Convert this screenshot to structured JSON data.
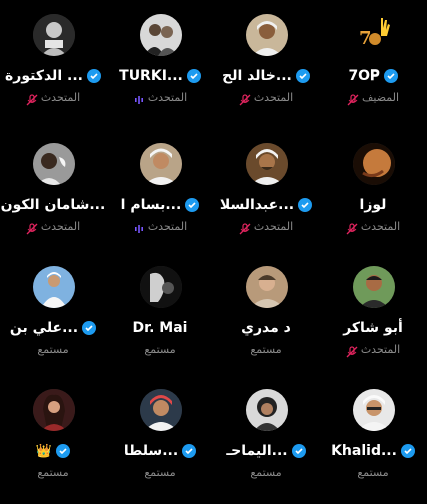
{
  "colors": {
    "background": "#000000",
    "verified": "#1d9bf0",
    "muted_mic": "#e0245e",
    "speaking": "#7856ff",
    "role_text": "#8b8b8b"
  },
  "participants": [
    {
      "name": "7O𝐏",
      "role": "المضيف",
      "verified": true,
      "mic": "muted",
      "avatar": "hand-logo"
    },
    {
      "name": "خالد الح...",
      "role": "المتحدث",
      "verified": true,
      "mic": "muted",
      "avatar": "photo"
    },
    {
      "name": "TURKI...",
      "role": "المتحدث",
      "verified": true,
      "mic": "speaking",
      "avatar": "photo"
    },
    {
      "name": "الدكتورة ...",
      "role": "المتحدث",
      "verified": true,
      "mic": "muted",
      "avatar": "photo"
    },
    {
      "name": "لوزا",
      "role": "المتحدث",
      "verified": false,
      "mic": "muted",
      "avatar": "photo"
    },
    {
      "name": "عبدالسلا...",
      "role": "المتحدث",
      "verified": true,
      "mic": "muted",
      "avatar": "photo"
    },
    {
      "name": "بسام ا...",
      "role": "المتحدث",
      "verified": true,
      "mic": "speaking",
      "avatar": "photo"
    },
    {
      "name": "شامان الكون...",
      "role": "المتحدث",
      "verified": false,
      "mic": "muted",
      "avatar": "photo"
    },
    {
      "name": "أبو شاكر",
      "role": "المتحدث",
      "verified": false,
      "mic": "muted",
      "avatar": "photo"
    },
    {
      "name": "د مدري",
      "role": "مستمع",
      "verified": false,
      "mic": "none",
      "avatar": "photo"
    },
    {
      "name": "Dr. Mai",
      "role": "مستمع",
      "verified": false,
      "mic": "none",
      "avatar": "photo"
    },
    {
      "name": "علي بن...",
      "role": "مستمع",
      "verified": true,
      "mic": "none",
      "avatar": "photo"
    },
    {
      "name": "Khalid...",
      "role": "مستمع",
      "verified": true,
      "mic": "none",
      "avatar": "photo"
    },
    {
      "name": "اليماحـ...",
      "role": "مستمع",
      "verified": true,
      "mic": "none",
      "avatar": "photo"
    },
    {
      "name": "سلطا...",
      "role": "مستمع",
      "verified": true,
      "mic": "none",
      "avatar": "photo"
    },
    {
      "name": "👑",
      "role": "مستمع",
      "verified": true,
      "mic": "none",
      "avatar": "photo"
    }
  ]
}
